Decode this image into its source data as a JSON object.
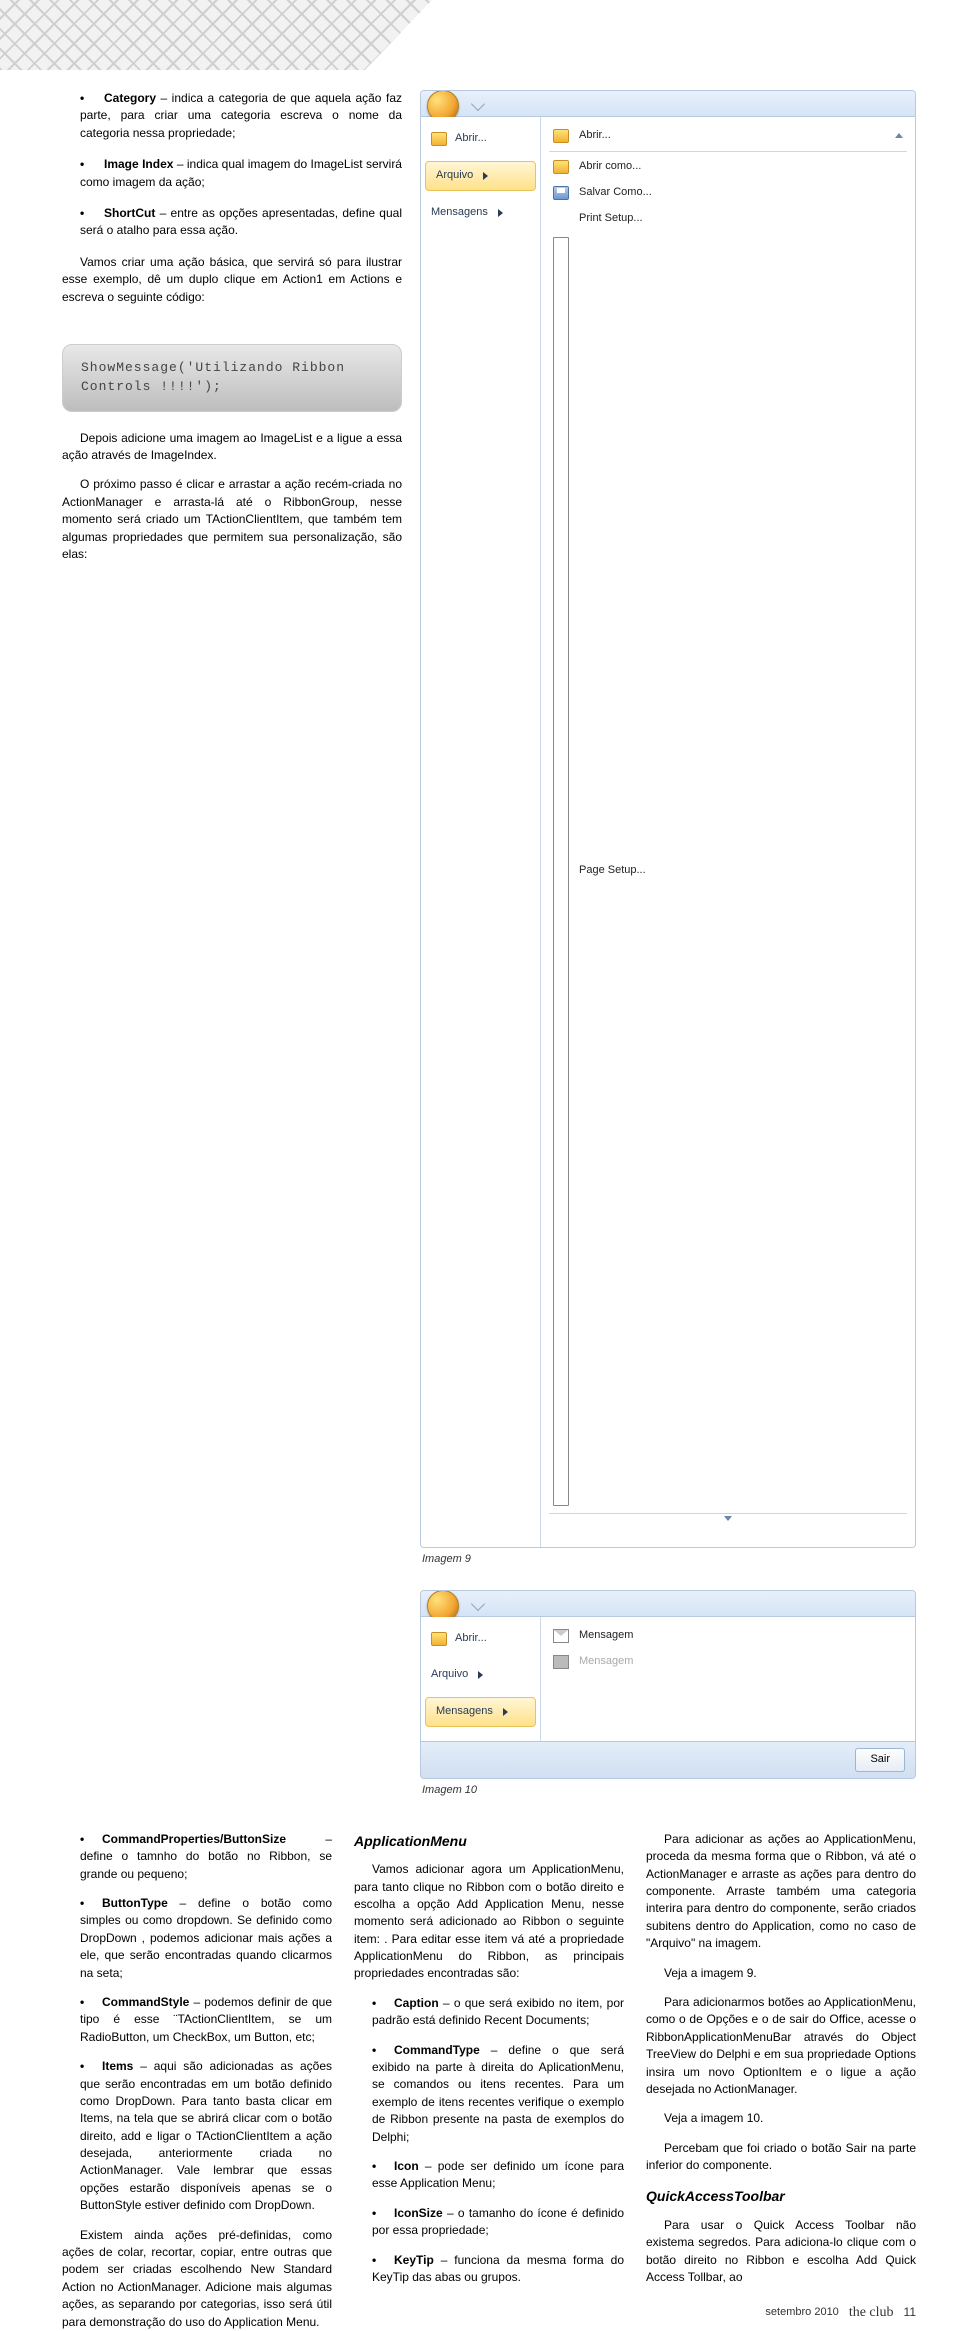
{
  "leftcol": {
    "bullets1": [
      {
        "term": "Category",
        "text": " – indica a categoria de que aquela ação faz parte, para criar uma categoria escreva o nome da categoria nessa propriedade;"
      },
      {
        "term": "Image Index",
        "text": " – indica qual imagem do ImageList servirá como imagem da ação;"
      },
      {
        "term": "ShortCut",
        "text": " – entre as opções apresentadas, define qual será o atalho para essa ação."
      }
    ],
    "para1": "Vamos criar uma ação básica, que servirá só para ilustrar esse exemplo, dê um duplo clique em Action1 em Actions e escreva o seguinte código:",
    "code": "ShowMessage('Utilizando Ribbon Controls !!!!');",
    "para2": "Depois adicione uma imagem ao ImageList e a ligue a essa ação através de ImageIndex.",
    "para3": "O próximo passo é clicar e arrastar a ação recém-criada no ActionManager e arrasta-lá até o RibbonGroup, nesse momento será criado um TActionClientItem, que também tem algumas propriedades que permitem sua personalização, são elas:"
  },
  "shot9": {
    "left": {
      "abrir": "Abrir...",
      "arquivo": "Arquivo",
      "mensagens": "Mensagens"
    },
    "right": {
      "abrir": "Abrir...",
      "abrir_como": "Abrir como...",
      "salvar_como": "Salvar Como...",
      "print_setup": "Print Setup...",
      "page_setup": "Page Setup..."
    },
    "caption": "Imagem 9"
  },
  "shot10": {
    "left": {
      "abrir": "Abrir...",
      "arquivo": "Arquivo",
      "mensagens": "Mensagens"
    },
    "right": {
      "mensagem": "Mensagem",
      "mensagem2": "Mensagem"
    },
    "sair": "Sair",
    "caption": "Imagem 10"
  },
  "col1": {
    "bullets": [
      {
        "term": "CommandProperties/ButtonSize",
        "text": " – define o tamnho do botão no Ribbon, se grande ou pequeno;"
      },
      {
        "term": "ButtonType",
        "text": " – define o botão como simples ou como dropdown. Se definido como DropDown , podemos adicionar mais ações a ele, que serão encontradas quando clicarmos na seta;"
      },
      {
        "term": "CommandStyle",
        "text": " – podemos definir de que tipo é esse ¨TActionClientItem, se um RadioButton, um CheckBox, um Button, etc;"
      },
      {
        "term": "Items",
        "text": " – aqui são adicionadas as ações que serão encontradas em um botão definido como DropDown. Para tanto basta clicar em Items, na tela que se abrirá clicar com o botão direito, add e ligar o TActionClientItem a ação desejada, anteriormente criada no ActionManager. Vale lembrar que essas opções estarão disponíveis apenas se o ButtonStyle estiver definido com DropDown."
      }
    ],
    "paraEnd": "Existem ainda ações pré-definidas, como ações de colar, recortar, copiar, entre outras que podem ser criadas escolhendo New Standard Action no ActionManager. Adicione mais algumas ações, as separando por categorias, isso será útil para demonstração do uso do Application Menu."
  },
  "col2": {
    "h3": "ApplicationMenu",
    "para1": "Vamos adicionar agora um ApplicationMenu, para tanto clique no Ribbon com o botão direito e escolha a opção Add Application Menu, nesse momento será adicionado ao Ribbon o seguinte item: . Para editar esse item vá até a propriedade ApplicationMenu do Ribbon, as principais propriedades encontradas são:",
    "bullets": [
      {
        "term": "Caption",
        "text": " – o que será exibido no item, por padrão está definido Recent Documents;"
      },
      {
        "term": "CommandType",
        "text": " – define o que será exibido na parte à direita do AplicationMenu, se comandos ou itens recentes. Para um exemplo de itens recentes verifique o exemplo de Ribbon presente na pasta de exemplos do Delphi;"
      },
      {
        "term": "Icon",
        "text": " – pode ser definido um ícone para esse Application Menu;"
      },
      {
        "term": "IconSize",
        "text": " – o tamanho do ícone é definido por essa propriedade;"
      },
      {
        "term": "KeyTip",
        "text": " – funciona da mesma forma do KeyTip das abas ou grupos."
      }
    ]
  },
  "col3": {
    "para1": "Para adicionar as ações ao ApplicationMenu, proceda da mesma forma que o Ribbon, vá até o ActionManager e arraste as ações para dentro do componente. Arraste também uma categoria interira para dentro do componente, serão criados subitens dentro do Application, como no caso de \"Arquivo\" na imagem.",
    "para2": "Veja a imagem 9.",
    "para3": "Para adicionarmos botões ao ApplicationMenu, como o de Opções e o de sair do Office, acesse o RibbonApplicationMenuBar através do Object TreeView do Delphi e em sua propriedade Options insira um novo OptionItem e o ligue a ação desejada no ActionManager.",
    "para4": "Veja a imagem 10.",
    "para5": "Percebam que foi criado o botão Sair na parte inferior do componente.",
    "h3": "QuickAccessToolbar",
    "para6": "Para usar o Quick Access Toolbar não existema segredos. Para adiciona-lo clique com o botão direito no Ribbon e escolha Add Quick Access Tollbar, ao"
  },
  "footer": {
    "month": "setembro 2010",
    "brand": "the club",
    "page": "11"
  }
}
